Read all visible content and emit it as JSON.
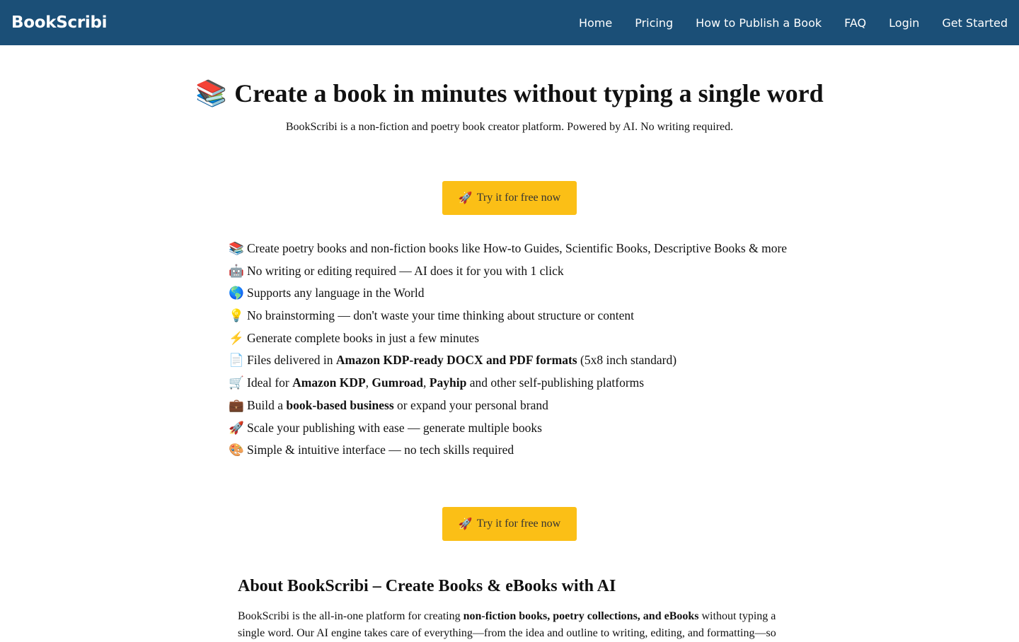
{
  "navbar": {
    "brand": "BookScribi",
    "links": [
      "Home",
      "Pricing",
      "How to Publish a Book",
      "FAQ",
      "Login",
      "Get Started"
    ]
  },
  "hero": {
    "emoji": "📚",
    "title": "Create a book in minutes without typing a single word",
    "subtitle": "BookScribi is a non-fiction and poetry book creator platform. Powered by AI. No writing required."
  },
  "cta": {
    "emoji": "🚀",
    "label": "Try it for free now"
  },
  "features": [
    {
      "emoji": "📚",
      "parts": [
        {
          "t": "Create poetry books and non-fiction books like How-to Guides, Scientific Books, Descriptive Books & more"
        }
      ]
    },
    {
      "emoji": "🤖",
      "parts": [
        {
          "t": "No writing or editing required — AI does it for you with 1 click"
        }
      ]
    },
    {
      "emoji": "🌎",
      "parts": [
        {
          "t": "Supports any language in the World"
        }
      ]
    },
    {
      "emoji": "💡",
      "parts": [
        {
          "t": "No brainstorming — don't waste your time thinking about structure or content"
        }
      ]
    },
    {
      "emoji": "⚡",
      "parts": [
        {
          "t": "Generate complete books in just a few minutes"
        }
      ]
    },
    {
      "emoji": "📄",
      "parts": [
        {
          "t": "Files delivered in "
        },
        {
          "t": "Amazon KDP-ready DOCX and PDF formats",
          "b": true
        },
        {
          "t": " (5x8 inch standard)"
        }
      ]
    },
    {
      "emoji": "🛒",
      "parts": [
        {
          "t": "Ideal for "
        },
        {
          "t": "Amazon KDP",
          "b": true
        },
        {
          "t": ", "
        },
        {
          "t": "Gumroad",
          "b": true
        },
        {
          "t": ", "
        },
        {
          "t": "Payhip",
          "b": true
        },
        {
          "t": " and other self-publishing platforms"
        }
      ]
    },
    {
      "emoji": "💼",
      "parts": [
        {
          "t": "Build a "
        },
        {
          "t": "book-based business",
          "b": true
        },
        {
          "t": " or expand your personal brand"
        }
      ]
    },
    {
      "emoji": "🚀",
      "parts": [
        {
          "t": "Scale your publishing with ease — generate multiple books"
        }
      ]
    },
    {
      "emoji": "🎨",
      "parts": [
        {
          "t": "Simple & intuitive interface — no tech skills required"
        }
      ]
    }
  ],
  "about": {
    "title": "About BookScribi – Create Books & eBooks with AI",
    "text_parts": [
      {
        "t": "BookScribi is the all-in-one platform for creating "
      },
      {
        "t": "non-fiction books, poetry collections, and eBooks",
        "b": true
      },
      {
        "t": " without typing a single word. Our AI engine takes care of everything—from the idea and outline to writing, editing, and formatting—so"
      }
    ]
  },
  "colors": {
    "navbar": "#1b4f77",
    "cta": "#fbbf16"
  }
}
